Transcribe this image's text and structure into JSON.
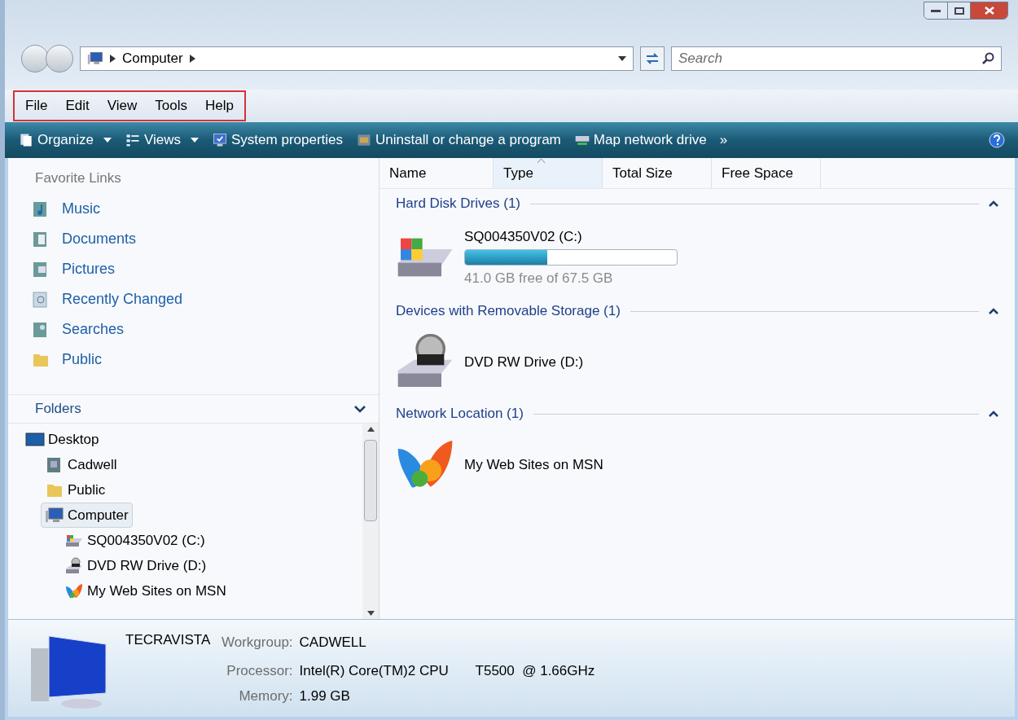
{
  "address_bar": {
    "crumbs": [
      "Computer"
    ]
  },
  "search": {
    "placeholder": "Search"
  },
  "menu_bar": {
    "highlighted": true,
    "items": [
      "File",
      "Edit",
      "View",
      "Tools",
      "Help"
    ]
  },
  "toolbar": {
    "items": [
      {
        "kind": "organize",
        "label": "Organize"
      },
      {
        "kind": "views",
        "label": "Views"
      },
      {
        "kind": "system",
        "label": "System properties"
      },
      {
        "kind": "uninstall",
        "label": "Uninstall or change a program"
      },
      {
        "kind": "map",
        "label": "Map network drive"
      }
    ],
    "overflow": "»"
  },
  "favorite_links": {
    "title": "Favorite Links",
    "items": [
      {
        "kind": "music",
        "label": "Music"
      },
      {
        "kind": "documents",
        "label": "Documents"
      },
      {
        "kind": "pictures",
        "label": "Pictures"
      },
      {
        "kind": "recent",
        "label": "Recently Changed"
      },
      {
        "kind": "searches",
        "label": "Searches"
      },
      {
        "kind": "folder",
        "label": "Public"
      }
    ]
  },
  "folders": {
    "title": "Folders",
    "expanded": true,
    "tree": [
      {
        "kind": "desktop",
        "label": "Desktop",
        "selected": false,
        "children": [
          {
            "kind": "user",
            "label": "Cadwell",
            "selected": false
          },
          {
            "kind": "folder",
            "label": "Public",
            "selected": false
          },
          {
            "kind": "computer",
            "label": "Computer",
            "selected": true,
            "children": [
              {
                "kind": "hdd",
                "label": "SQ004350V02 (C:)",
                "selected": false
              },
              {
                "kind": "dvd",
                "label": "DVD RW Drive (D:)",
                "selected": false
              },
              {
                "kind": "msn",
                "label": "My Web Sites on MSN",
                "selected": false
              }
            ]
          }
        ]
      }
    ]
  },
  "columns": [
    {
      "label": "Name",
      "sorted": false
    },
    {
      "label": "Type",
      "sorted": true
    },
    {
      "label": "Total Size",
      "sorted": false
    },
    {
      "label": "Free Space",
      "sorted": false
    }
  ],
  "groups": [
    {
      "title": "Hard Disk Drives (1)",
      "expanded": true,
      "items": [
        {
          "kind": "hdd",
          "name": "SQ004350V02 (C:)",
          "level": 0.39,
          "detail": "41.0 GB free of 67.5 GB"
        }
      ]
    },
    {
      "title": "Devices with Removable Storage (1)",
      "expanded": true,
      "items": [
        {
          "kind": "dvd",
          "name": "DVD RW Drive (D:)"
        }
      ]
    },
    {
      "title": "Network Location (1)",
      "expanded": true,
      "items": [
        {
          "kind": "msn",
          "name": "My Web Sites on MSN"
        }
      ]
    }
  ],
  "details": {
    "name": "TECRAVISTA",
    "rows": [
      {
        "label": "Workgroup:",
        "value": "CADWELL"
      },
      {
        "label": "Processor:",
        "value": "Intel(R) Core(TM)2 CPU       T5500  @ 1.66GHz"
      },
      {
        "label": "Memory:",
        "value": "1.99 GB"
      }
    ]
  }
}
